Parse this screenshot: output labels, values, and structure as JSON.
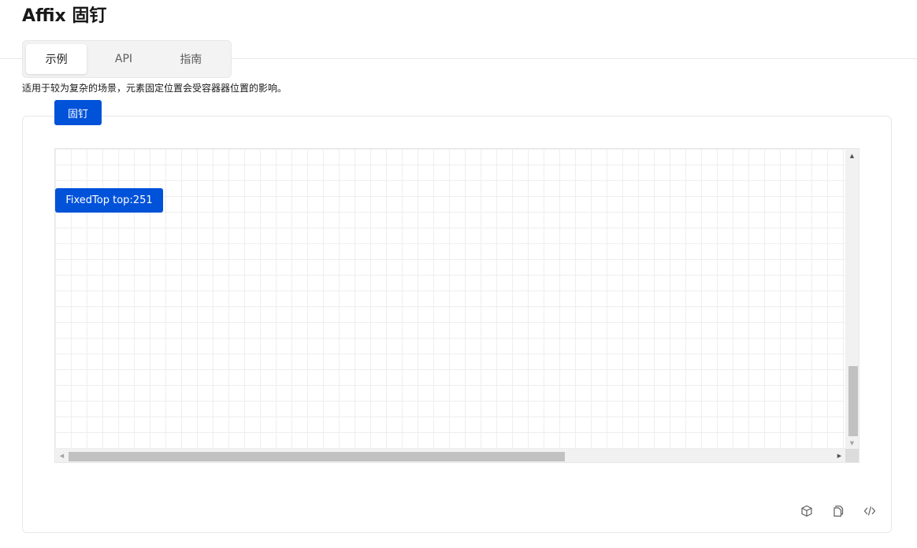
{
  "page": {
    "title": "Affix 固钉"
  },
  "tabs": [
    {
      "label": "示例",
      "active": true
    },
    {
      "label": "API",
      "active": false
    },
    {
      "label": "指南",
      "active": false
    }
  ],
  "demo": {
    "description": "适用于较为复杂的场景，元素固定位置会受容器器位置的影响。",
    "affix_button_label": "固钉",
    "fixedtop_button_label": "FixedTop top:251"
  },
  "actions": {
    "icons": [
      "cube-icon",
      "copy-icon",
      "code-icon"
    ]
  },
  "colors": {
    "primary": "#0052d9",
    "border": "#e7e7e7",
    "grid_line": "#eeeeee",
    "scrollbar_thumb": "#c1c1c1"
  }
}
